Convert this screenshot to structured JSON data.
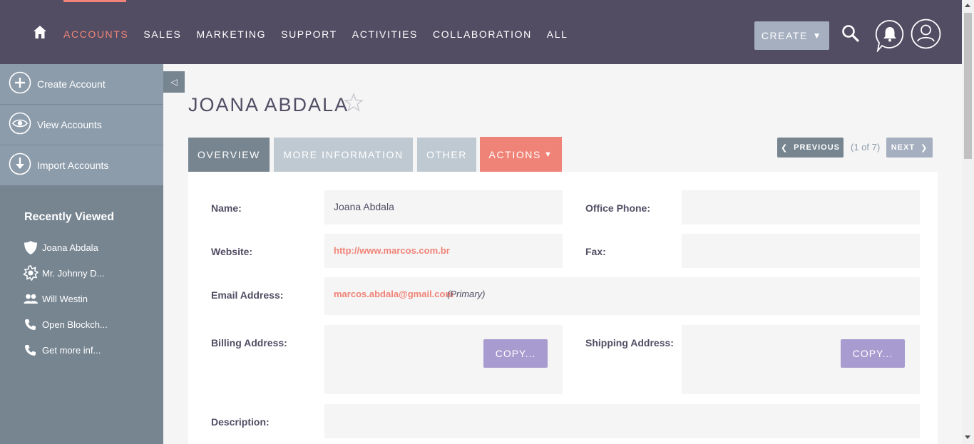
{
  "nav": {
    "items": [
      "ACCOUNTS",
      "SALES",
      "MARKETING",
      "SUPPORT",
      "ACTIVITIES",
      "COLLABORATION",
      "ALL"
    ],
    "create_label": "CREATE",
    "accent_color": "#f08377",
    "bar_color": "#534d64"
  },
  "sidebar": {
    "actions": [
      {
        "label": "Create Account",
        "icon": "plus-circle-icon"
      },
      {
        "label": "View Accounts",
        "icon": "eye-icon"
      },
      {
        "label": "Import Accounts",
        "icon": "import-arrow-icon"
      }
    ],
    "recent_title": "Recently Viewed",
    "recent": [
      {
        "label": "Joana Abdala",
        "icon": "shield-icon"
      },
      {
        "label": "Mr. Johnny D...",
        "icon": "badge-icon"
      },
      {
        "label": "Will Westin",
        "icon": "people-icon"
      },
      {
        "label": "Open Blockch...",
        "icon": "phone-icon"
      },
      {
        "label": "Get more inf...",
        "icon": "phone-icon"
      }
    ]
  },
  "record": {
    "title": "JOANA ABDALA",
    "tabs": [
      "OVERVIEW",
      "MORE INFORMATION",
      "OTHER",
      "ACTIONS"
    ],
    "pagination": {
      "prev": "PREVIOUS",
      "count": "(1 of 7)",
      "next": "NEXT"
    },
    "fields": {
      "name_label": "Name:",
      "name_value": "Joana Abdala",
      "office_phone_label": "Office Phone:",
      "website_label": "Website:",
      "website_value": "http://www.marcos.com.br",
      "fax_label": "Fax:",
      "email_label": "Email Address:",
      "email_value": "marcos.abdala@gmail.com",
      "email_tag": "(Primary)",
      "billing_label": "Billing Address:",
      "shipping_label": "Shipping Address:",
      "copy_label": "COPY...",
      "description_label": "Description:"
    }
  }
}
